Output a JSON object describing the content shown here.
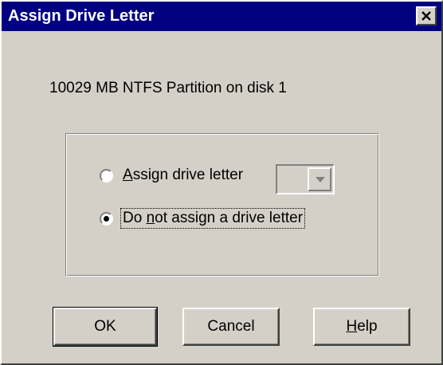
{
  "window": {
    "title": "Assign Drive Letter",
    "close_icon": "close-icon"
  },
  "partition_info": "10029 MB NTFS Partition on disk 1",
  "options": {
    "assign": {
      "label_accel": "A",
      "label_rest": "ssign drive letter",
      "selected": false
    },
    "no_assign": {
      "label_pre": "Do ",
      "label_accel": "n",
      "label_rest": "ot assign a drive letter",
      "selected": true
    },
    "drive_letter": {
      "value": "",
      "disabled": true
    }
  },
  "buttons": {
    "ok": "OK",
    "cancel": "Cancel",
    "help_accel": "H",
    "help_rest": "elp"
  },
  "colors": {
    "titlebar": "#000080",
    "face": "#d4d0c8"
  }
}
